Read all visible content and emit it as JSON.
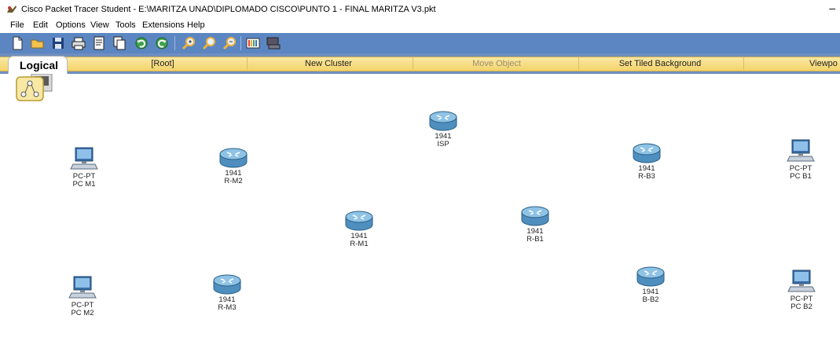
{
  "window": {
    "title": "Cisco Packet Tracer Student - E:\\MARITZA UNAD\\DIPLOMADO CISCO\\PUNTO 1 - FINAL MARITZA V3.pkt",
    "minimize": "–"
  },
  "menu": [
    "File",
    "Edit",
    "Options",
    "View",
    "Tools",
    "Extensions",
    "Help"
  ],
  "toolbar": {
    "buttons": [
      "new-file-icon",
      "open-folder-icon",
      "save-icon",
      "print-icon",
      "activity-wizard-icon",
      "copy-icon",
      "undo-icon",
      "redo-icon",
      "zoom-in-icon",
      "zoom-reset-icon",
      "zoom-out-icon",
      "palette-icon",
      "custom-device-icon"
    ]
  },
  "workspace_bar": {
    "logical_tab": "Logical",
    "root": "[Root]",
    "new_cluster": "New Cluster",
    "move_object": "Move Object",
    "set_tiled_background": "Set Tiled Background",
    "viewport": "Viewpo"
  },
  "devices": [
    {
      "id": "pc-m1",
      "kind": "pc",
      "model": "PC-PT",
      "name": "PC M1"
    },
    {
      "id": "r-m2",
      "kind": "router",
      "model": "1941",
      "name": "R-M2"
    },
    {
      "id": "isp",
      "kind": "router",
      "model": "1941",
      "name": "ISP"
    },
    {
      "id": "r-b3",
      "kind": "router",
      "model": "1941",
      "name": "R-B3"
    },
    {
      "id": "pc-b1",
      "kind": "pc",
      "model": "PC-PT",
      "name": "PC B1"
    },
    {
      "id": "r-m1",
      "kind": "router",
      "model": "1941",
      "name": "R-M1"
    },
    {
      "id": "r-b1",
      "kind": "router",
      "model": "1941",
      "name": "R-B1"
    },
    {
      "id": "pc-m2",
      "kind": "pc",
      "model": "PC-PT",
      "name": "PC M2"
    },
    {
      "id": "r-m3",
      "kind": "router",
      "model": "1941",
      "name": "R-M3"
    },
    {
      "id": "b-b2",
      "kind": "router",
      "model": "1941",
      "name": "B-B2"
    },
    {
      "id": "pc-b2",
      "kind": "pc",
      "model": "PC-PT",
      "name": "PC B2"
    }
  ]
}
